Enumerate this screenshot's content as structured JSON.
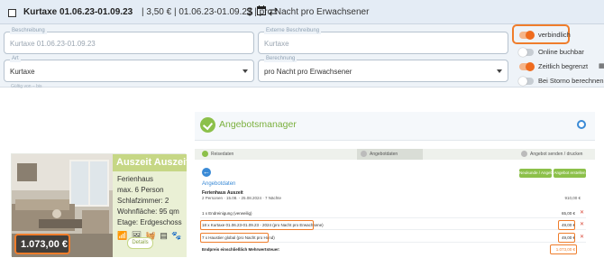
{
  "top_panel": {
    "header": {
      "title": "Kurtaxe 01.06.23-01.09.23",
      "meta": "| 3,50 € | 01.06.23-01.09.23 | pro Nacht pro Erwachsener",
      "icons": [
        "dollar-icon",
        "calendar-icon",
        "repeat-icon"
      ]
    },
    "fields": {
      "beschreibung": {
        "label": "Beschreibung",
        "value": "Kurtaxe 01.06.23-01.09.23"
      },
      "externe": {
        "label": "Externe Beschreibung",
        "placeholder": "Kurtaxe"
      },
      "art": {
        "label": "Art",
        "value": "Kurtaxe"
      },
      "berechnung": {
        "label": "Berechnung",
        "value": "pro Nacht pro Erwachsener"
      }
    },
    "peek_label": "Gültig von – bis",
    "toggles": [
      {
        "label": "verbindlich",
        "on": true
      },
      {
        "label": "Online buchbar",
        "on": false
      },
      {
        "label": "Zeitlich begrenzt",
        "on": true
      },
      {
        "label": "Bei Storno berechnen",
        "on": false
      }
    ],
    "colors": {
      "accent": "#ef6c1f",
      "highlight": "#ef7d2b"
    }
  },
  "card": {
    "title": "Auszeit Auszeit",
    "info": [
      "Ferienhaus",
      "max. 6 Person",
      "Schlafzimmer: 2",
      "Wohnfläche: 95 qm",
      "Etage: Erdgeschoss"
    ],
    "amenities": "📶 🖼 🧺 ▤ 🐾",
    "price": "1.073,00 €",
    "details_label": "Details",
    "colors": {
      "title_bar": "#c6d785",
      "info_bg": "#eaf0d5"
    }
  },
  "offer": {
    "title": "Angebotsmanager",
    "steps": [
      "Reisedaten",
      "Angebotdaten",
      "Angebot senden / drucken"
    ],
    "buttons": [
      "Neukunde / Angebot",
      "Angebot erstellen"
    ],
    "section_title": "Angebotdaten",
    "ferienhaus": {
      "name": "Ferienhaus Auszeit",
      "desc": "2 Personen · 15.08. - 25.08.2024 · 7 Nächte",
      "price": "910,00 €"
    },
    "rows": [
      {
        "label": "1 x Endreinigung (verweilig)",
        "price": "65,00 €"
      },
      {
        "label": "18 x Kurtaxe 01.06.23-01.09.23 - 2024 (pro Nacht pro Erwachsene)",
        "price": "49,00 €"
      },
      {
        "label": "7 x Haustier global (pro Nacht pro Hund)",
        "price": "49,00 €"
      }
    ],
    "total": {
      "label": "Endpreis einschließlich Mehrwertsteuer:",
      "price": "1.073,00 €"
    },
    "colors": {
      "brand_green": "#8cc04a",
      "link_blue": "#3a8ad6"
    }
  }
}
